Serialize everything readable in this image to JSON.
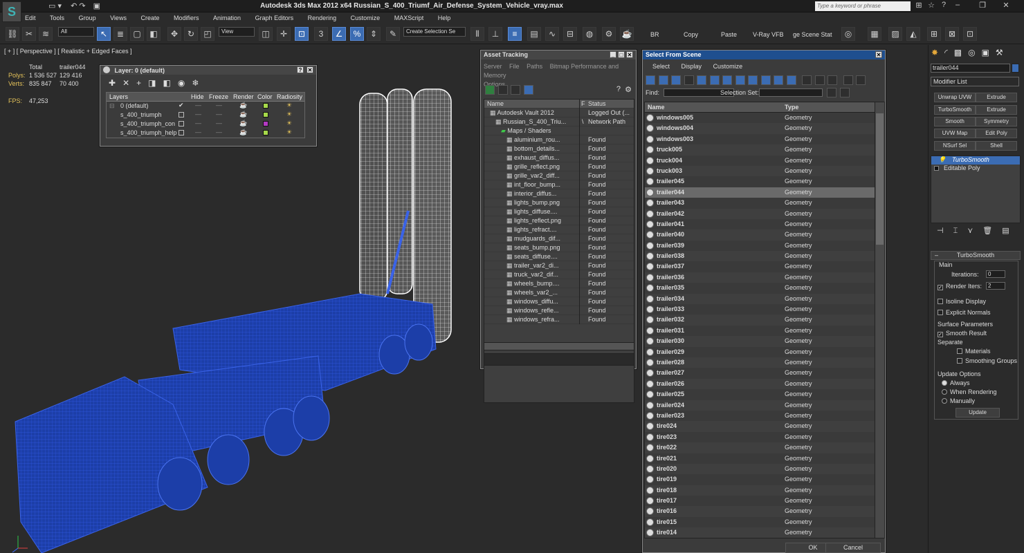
{
  "app": {
    "title": "Autodesk 3ds Max  2012 x64     Russian_S_400_Triumf_Air_Defense_System_Vehicle_vray.max",
    "logo_text": "S",
    "search_placeholder": "Type a keyword or phrase"
  },
  "menu": [
    "Edit",
    "Tools",
    "Group",
    "Views",
    "Create",
    "Modifiers",
    "Animation",
    "Graph Editors",
    "Rendering",
    "Customize",
    "MAXScript",
    "Help"
  ],
  "toolbar": {
    "filter_value": "All",
    "view_value": "View",
    "selection_set": "Create Selection Se",
    "snap_number": "3",
    "labels": [
      "BR",
      "Copy",
      "Paste",
      "V-Ray VFB",
      "ge Scene Stat"
    ]
  },
  "viewport": {
    "label": "[ + ] [ Perspective ] [ Realistic + Edged Faces ]",
    "stats": {
      "col1_header": "Total",
      "col2_header": "trailer044",
      "polys_label": "Polys:",
      "polys_total": "1 536 527",
      "polys_sel": "129 416",
      "verts_label": "Verts:",
      "verts_total": "835 847",
      "verts_sel": "70 400",
      "fps_label": "FPS:",
      "fps_value": "47,253"
    }
  },
  "layer_window": {
    "title": "Layer: 0 (default)",
    "columns": [
      "Layers",
      "Hide",
      "Freeze",
      "Render",
      "Color",
      "Radiosity"
    ],
    "rows": [
      {
        "name": "0 (default)",
        "color": "#a6d94a",
        "checked": true
      },
      {
        "name": "s_400_triumph",
        "color": "#a6d94a",
        "checked": false
      },
      {
        "name": "s_400_triumph_con",
        "color": "#b33ac2",
        "checked": false
      },
      {
        "name": "s_400_triumph_help",
        "color": "#a6d94a",
        "checked": false
      }
    ]
  },
  "asset_tracking": {
    "title": "Asset Tracking",
    "menu": [
      "Server",
      "File",
      "Paths",
      "Bitmap Performance and Memory",
      "Options"
    ],
    "columns": [
      "Name",
      "F",
      "Status"
    ],
    "rows": [
      {
        "name": "Autodesk Vault 2012",
        "status": "Logged Out (...",
        "indent": 1
      },
      {
        "name": "Russian_S_400_Triu...",
        "flag": "\\",
        "status": "Network Path",
        "indent": 2
      },
      {
        "name": "Maps / Shaders",
        "status": "",
        "indent": 3
      },
      {
        "name": "aluminium_rou...",
        "status": "Found",
        "indent": 4
      },
      {
        "name": "bottom_details...",
        "status": "Found",
        "indent": 4
      },
      {
        "name": "exhaust_diffus...",
        "status": "Found",
        "indent": 4
      },
      {
        "name": "grille_reflect.png",
        "status": "Found",
        "indent": 4
      },
      {
        "name": "grille_var2_diff...",
        "status": "Found",
        "indent": 4
      },
      {
        "name": "int_floor_bump...",
        "status": "Found",
        "indent": 4
      },
      {
        "name": "interior_diffus...",
        "status": "Found",
        "indent": 4
      },
      {
        "name": "lights_bump.png",
        "status": "Found",
        "indent": 4
      },
      {
        "name": "lights_diffuse....",
        "status": "Found",
        "indent": 4
      },
      {
        "name": "lights_reflect.png",
        "status": "Found",
        "indent": 4
      },
      {
        "name": "lights_refract....",
        "status": "Found",
        "indent": 4
      },
      {
        "name": "mudguards_dif...",
        "status": "Found",
        "indent": 4
      },
      {
        "name": "seats_bump.png",
        "status": "Found",
        "indent": 4
      },
      {
        "name": "seats_diffuse....",
        "status": "Found",
        "indent": 4
      },
      {
        "name": "trailer_var2_di...",
        "status": "Found",
        "indent": 4
      },
      {
        "name": "truck_var2_dif...",
        "status": "Found",
        "indent": 4
      },
      {
        "name": "wheels_bump....",
        "status": "Found",
        "indent": 4
      },
      {
        "name": "wheels_var2_...",
        "status": "Found",
        "indent": 4
      },
      {
        "name": "windows_diffu...",
        "status": "Found",
        "indent": 4
      },
      {
        "name": "windows_refle...",
        "status": "Found",
        "indent": 4
      },
      {
        "name": "windows_refra...",
        "status": "Found",
        "indent": 4
      }
    ]
  },
  "select_from_scene": {
    "title": "Select From Scene",
    "menu": [
      "Select",
      "Display",
      "Customize"
    ],
    "find_label": "Find:",
    "selection_set_label": "Selection Set:",
    "columns": [
      "Name",
      "Type"
    ],
    "rows": [
      {
        "name": "windows005",
        "type": "Geometry"
      },
      {
        "name": "windows004",
        "type": "Geometry"
      },
      {
        "name": "windows003",
        "type": "Geometry"
      },
      {
        "name": "truck005",
        "type": "Geometry"
      },
      {
        "name": "truck004",
        "type": "Geometry"
      },
      {
        "name": "truck003",
        "type": "Geometry"
      },
      {
        "name": "trailer045",
        "type": "Geometry"
      },
      {
        "name": "trailer044",
        "type": "Geometry"
      },
      {
        "name": "trailer043",
        "type": "Geometry"
      },
      {
        "name": "trailer042",
        "type": "Geometry"
      },
      {
        "name": "trailer041",
        "type": "Geometry"
      },
      {
        "name": "trailer040",
        "type": "Geometry"
      },
      {
        "name": "trailer039",
        "type": "Geometry"
      },
      {
        "name": "trailer038",
        "type": "Geometry"
      },
      {
        "name": "trailer037",
        "type": "Geometry"
      },
      {
        "name": "trailer036",
        "type": "Geometry"
      },
      {
        "name": "trailer035",
        "type": "Geometry"
      },
      {
        "name": "trailer034",
        "type": "Geometry"
      },
      {
        "name": "trailer033",
        "type": "Geometry"
      },
      {
        "name": "trailer032",
        "type": "Geometry"
      },
      {
        "name": "trailer031",
        "type": "Geometry"
      },
      {
        "name": "trailer030",
        "type": "Geometry"
      },
      {
        "name": "trailer029",
        "type": "Geometry"
      },
      {
        "name": "trailer028",
        "type": "Geometry"
      },
      {
        "name": "trailer027",
        "type": "Geometry"
      },
      {
        "name": "trailer026",
        "type": "Geometry"
      },
      {
        "name": "trailer025",
        "type": "Geometry"
      },
      {
        "name": "trailer024",
        "type": "Geometry"
      },
      {
        "name": "trailer023",
        "type": "Geometry"
      },
      {
        "name": "tire024",
        "type": "Geometry"
      },
      {
        "name": "tire023",
        "type": "Geometry"
      },
      {
        "name": "tire022",
        "type": "Geometry"
      },
      {
        "name": "tire021",
        "type": "Geometry"
      },
      {
        "name": "tire020",
        "type": "Geometry"
      },
      {
        "name": "tire019",
        "type": "Geometry"
      },
      {
        "name": "tire018",
        "type": "Geometry"
      },
      {
        "name": "tire017",
        "type": "Geometry"
      },
      {
        "name": "tire016",
        "type": "Geometry"
      },
      {
        "name": "tire015",
        "type": "Geometry"
      },
      {
        "name": "tire014",
        "type": "Geometry"
      }
    ],
    "highlighted": "trailer044",
    "ok_label": "OK",
    "cancel_label": "Cancel"
  },
  "command_panel": {
    "object_name": "trailer044",
    "modifier_list": "Modifier List",
    "buttons": [
      "Unwrap UVW",
      "Extrude",
      "TurboSmooth",
      "Extrude",
      "Smooth",
      "Symmetry",
      "UVW Map",
      "Edit Poly",
      "NSurf Sel",
      "Shell"
    ],
    "stack": [
      "TurboSmooth",
      "Editable Poly"
    ],
    "rollout_title": "TurboSmooth",
    "main_label": "Main",
    "iterations_label": "Iterations:",
    "iterations_value": "0",
    "render_iters_label": "Render Iters:",
    "render_iters_value": "2",
    "isoline_label": "Isoline Display",
    "explicit_normals_label": "Explicit Normals",
    "surface_params_label": "Surface Parameters",
    "smooth_result_label": "Smooth Result",
    "separate_label": "Separate",
    "materials_label": "Materials",
    "smoothing_groups_label": "Smoothing Groups",
    "update_options_label": "Update Options",
    "always_label": "Always",
    "when_rendering_label": "When Rendering",
    "manually_label": "Manually",
    "update_button": "Update"
  },
  "colors": {
    "accent": "#3b6cb3",
    "wire_blue": "#1f45c4",
    "wire_white": "#ffffff",
    "bg": "#2b2b2b"
  }
}
